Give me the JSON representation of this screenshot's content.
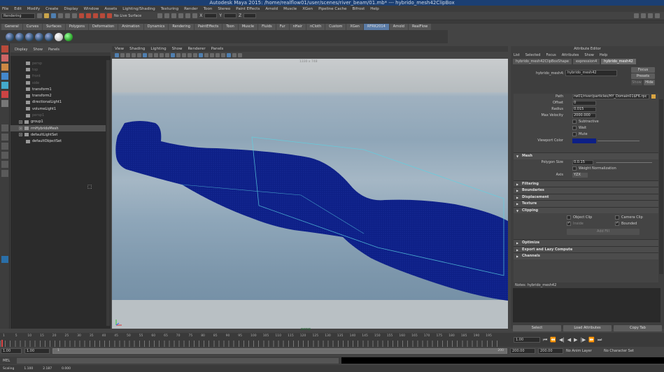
{
  "window": {
    "title": "Autodesk Maya 2015: /home/realflow01/user/scenes/river_beam/01.mb* --- hybrido_mesh42ClipBox"
  },
  "menubar": [
    "File",
    "Edit",
    "Modify",
    "Create",
    "Display",
    "Window",
    "Assets",
    "Lighting/Shading",
    "Texturing",
    "Render",
    "Toon",
    "Stereo",
    "Paint Effects",
    "Arnold",
    "Muscle",
    "XGen",
    "Pipeline Cache",
    "Bifrost",
    "Help"
  ],
  "statusline": {
    "mode": "Rendering",
    "live_surface": "No Live Surface",
    "x_label": "X",
    "y_label": "Y",
    "z_label": "Z"
  },
  "shelf": {
    "tabs": [
      "General",
      "Curves",
      "Surfaces",
      "Polygons",
      "Deformation",
      "Animation",
      "Dynamics",
      "Rendering",
      "PaintEffects",
      "Toon",
      "Muscle",
      "Fluids",
      "Fur",
      "nHair",
      "nCloth",
      "Custom",
      "XGen",
      "RFRK2014",
      "Arnold",
      "RealFlow"
    ],
    "active_tab": "RFRK2014"
  },
  "outliner": {
    "menu": [
      "Display",
      "Show",
      "Panels"
    ],
    "items": [
      {
        "label": "persp",
        "dim": true,
        "group": false
      },
      {
        "label": "top",
        "dim": true,
        "group": false
      },
      {
        "label": "front",
        "dim": true,
        "group": false
      },
      {
        "label": "side",
        "dim": true,
        "group": false
      },
      {
        "label": "transform1",
        "dim": false,
        "group": false
      },
      {
        "label": "transform2",
        "dim": false,
        "group": false
      },
      {
        "label": "directionalLight1",
        "dim": false,
        "group": false
      },
      {
        "label": "volumeLight1",
        "dim": false,
        "group": false
      },
      {
        "label": "persp1",
        "dim": true,
        "group": false
      },
      {
        "label": "group1",
        "dim": false,
        "group": true
      },
      {
        "label": "rmHybridoMesh",
        "dim": false,
        "group": true,
        "selected": true
      },
      {
        "label": "defaultLightSet",
        "dim": false,
        "group": true
      },
      {
        "label": "defaultObjectSet",
        "dim": false,
        "group": false
      }
    ]
  },
  "viewport": {
    "menu": [
      "View",
      "Shading",
      "Lighting",
      "Show",
      "Renderer",
      "Panels"
    ],
    "camera_label": "persp",
    "grid_label": "1330 x 748",
    "mesh_color": "#0d1f86"
  },
  "attribute_editor": {
    "title": "Attribute Editor",
    "menu": [
      "List",
      "Selected",
      "Focus",
      "Attributes",
      "Show",
      "Help"
    ],
    "tabs": [
      "hybrido_mesh42ClipBoxShape",
      "expression4",
      "hybrido_mesh42"
    ],
    "active_tab": "hybrido_mesh42",
    "node_label": "hybrido_mesh4:",
    "node_value": "hybrido_mesh42",
    "focus_btn": "Focus",
    "presets_btn": "Presets",
    "show_btn": "Show",
    "hide_btn": "Hide",
    "path_label": "Path",
    "path_value": "rw01/river/particles/HY_Domain01$F6.rpc",
    "offset_label": "Offset",
    "offset_value": "0",
    "radius_label": "Radius",
    "radius_value": "0.015",
    "maxvel_label": "Max Velocity",
    "maxvel_value": "2000.000",
    "subtractive": "Subtractive",
    "wait": "Wait",
    "mute": "Mute",
    "viewport_color_label": "Viewport Color",
    "sections": {
      "mesh": "Mesh",
      "polysize_label": "Polygon Size",
      "polysize_value": "0.0.15",
      "weight_norm": "Weight Normalization",
      "axis_label": "Axis",
      "axis_value": "YZX",
      "filtering": "Filtering",
      "boundaries": "Boundaries",
      "displacement": "Displacement",
      "texture": "Texture",
      "clipping": "Clipping",
      "object_clip": "Object Clip",
      "camera_clip": "Camera Clip",
      "inside": "Inside",
      "bounded": "Bounded",
      "add_fill": "Add Fill",
      "optimize": "Optimize",
      "export_lazy": "Export and Lazy Compute",
      "channels": "Channels"
    },
    "notes_label": "Notes: hybrido_mesh42",
    "buttons": [
      "Select",
      "Load Attributes",
      "Copy Tab"
    ]
  },
  "timeline": {
    "ticks": [
      "1",
      "5",
      "10",
      "15",
      "20",
      "25",
      "30",
      "35",
      "40",
      "45",
      "50",
      "55",
      "60",
      "65",
      "70",
      "75",
      "80",
      "85",
      "90",
      "95",
      "100",
      "105",
      "110",
      "115",
      "120",
      "125",
      "130",
      "135",
      "140",
      "145",
      "150",
      "155",
      "160",
      "165",
      "170",
      "175",
      "180",
      "185",
      "190",
      "195"
    ],
    "current_frame": "1.00",
    "start": "1.00",
    "range_start": "1.00",
    "range_slider_mark": "1",
    "range_end_mark": "200",
    "end": "200.00",
    "anim_end": "200.00",
    "anim_layer": "No Anim Layer",
    "char_set": "No Character Set"
  },
  "cmdline": {
    "label": "MEL"
  },
  "helpline": {
    "label": "Scaling",
    "v1": "1.100",
    "v2": "2.187",
    "v3": "0.000"
  }
}
